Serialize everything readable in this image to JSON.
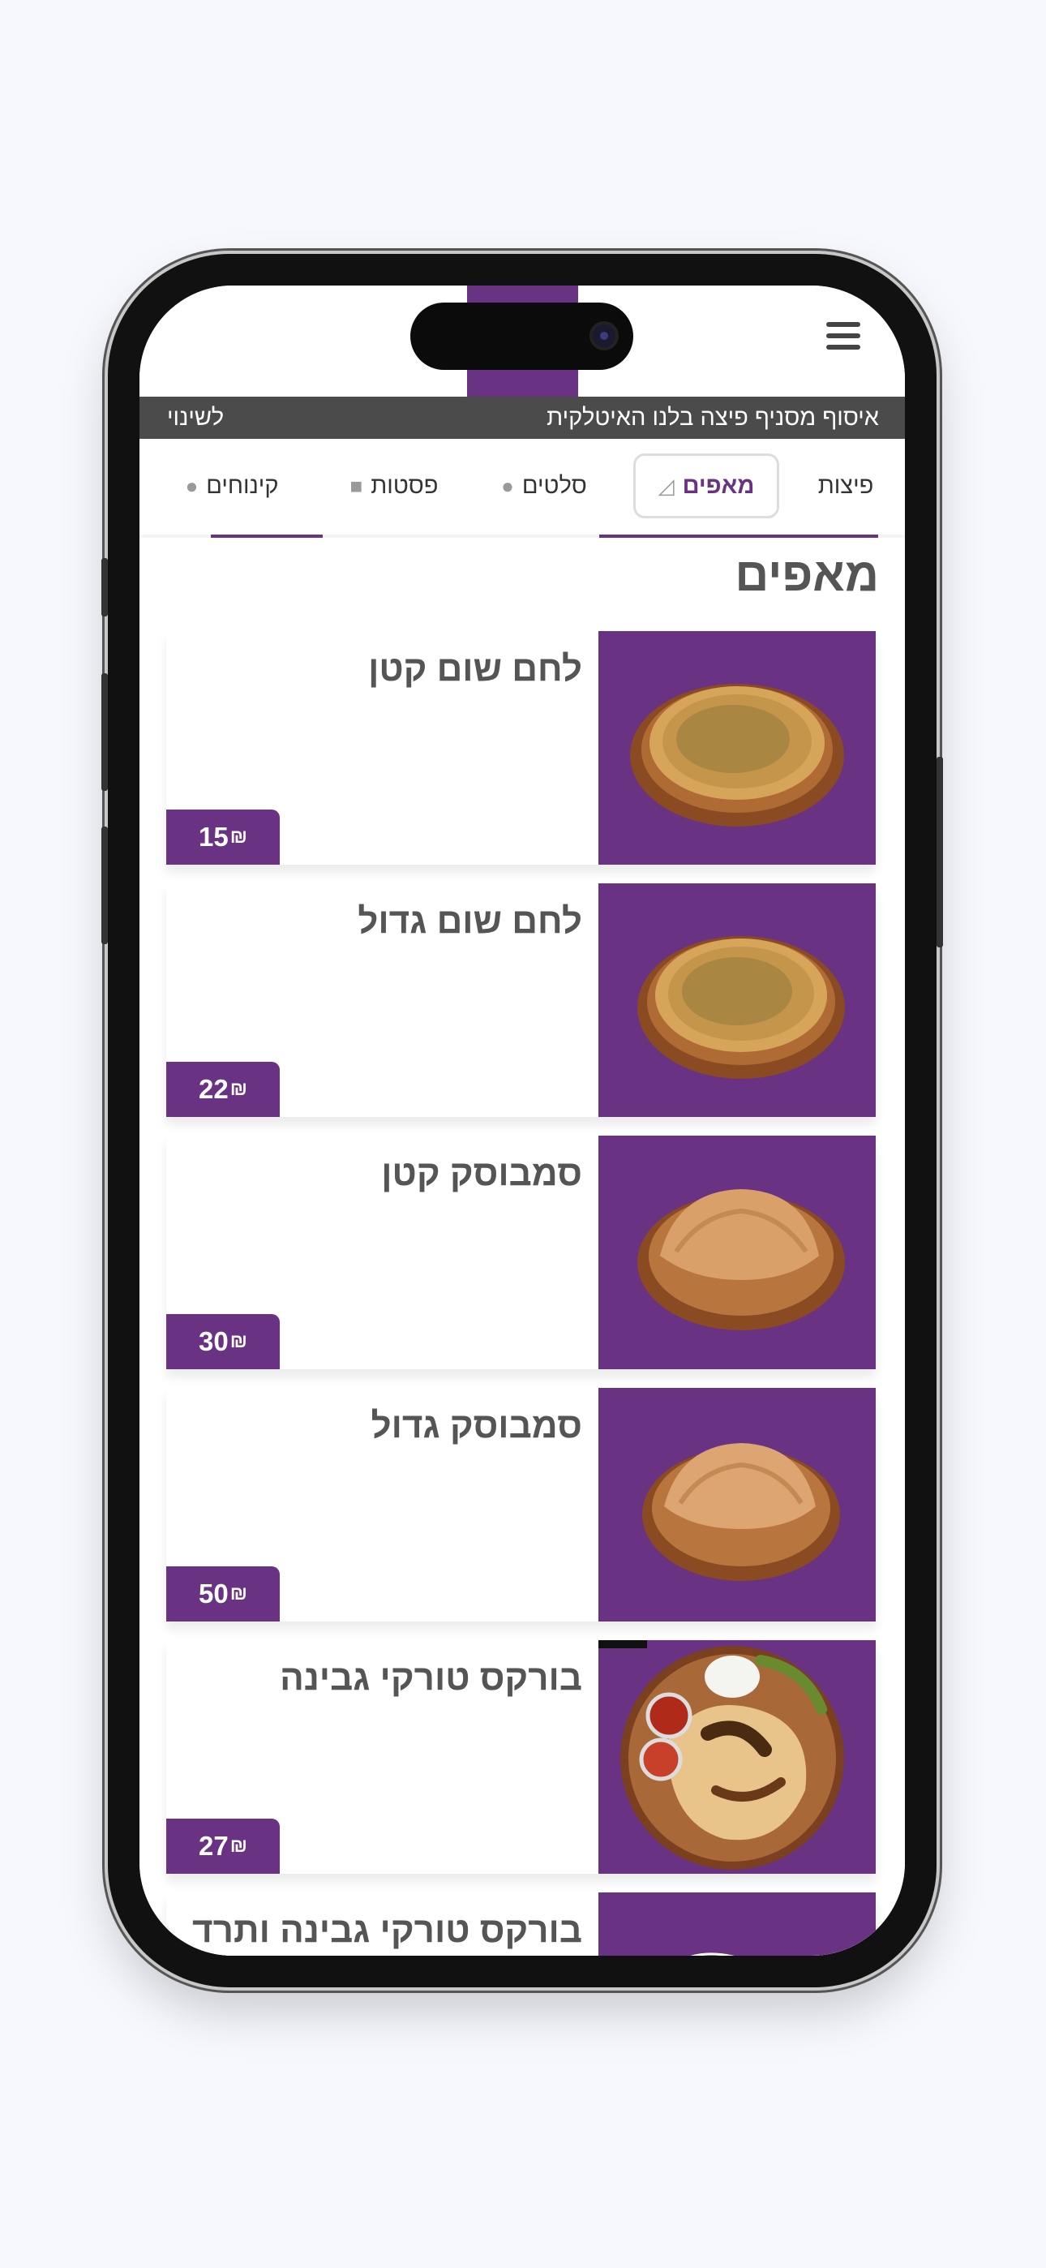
{
  "header": {
    "restaurant_line": "איסוף מסניף פיצה בלנו האיטלקית",
    "change_label": "לשינוי"
  },
  "tabs": [
    {
      "label": "פיצות",
      "icon": "pizza-icon"
    },
    {
      "label": "מאפים",
      "icon": "pastry-icon"
    },
    {
      "label": "סלטים",
      "icon": "salad-icon"
    },
    {
      "label": "פסטות",
      "icon": "pasta-icon"
    },
    {
      "label": "קינוחים",
      "icon": "dessert-icon"
    }
  ],
  "active_tab": "מאפים",
  "section": {
    "title": "מאפים",
    "items": [
      {
        "name": "לחם שום קטן",
        "price": "15",
        "currency": "₪"
      },
      {
        "name": "לחם שום גדול",
        "price": "22",
        "currency": "₪"
      },
      {
        "name": "סמבוסק קטן",
        "price": "30",
        "currency": "₪"
      },
      {
        "name": "סמבוסק גדול",
        "price": "50",
        "currency": "₪"
      },
      {
        "name": "בורקס טורקי גבינה",
        "price": "27",
        "currency": "₪"
      },
      {
        "name": "בורקס טורקי גבינה ותרד",
        "price": "",
        "currency": ""
      }
    ]
  },
  "colors": {
    "brand_purple": "#6a3282",
    "info_bar": "#4b4b4b",
    "background": "#f6f8fe"
  }
}
